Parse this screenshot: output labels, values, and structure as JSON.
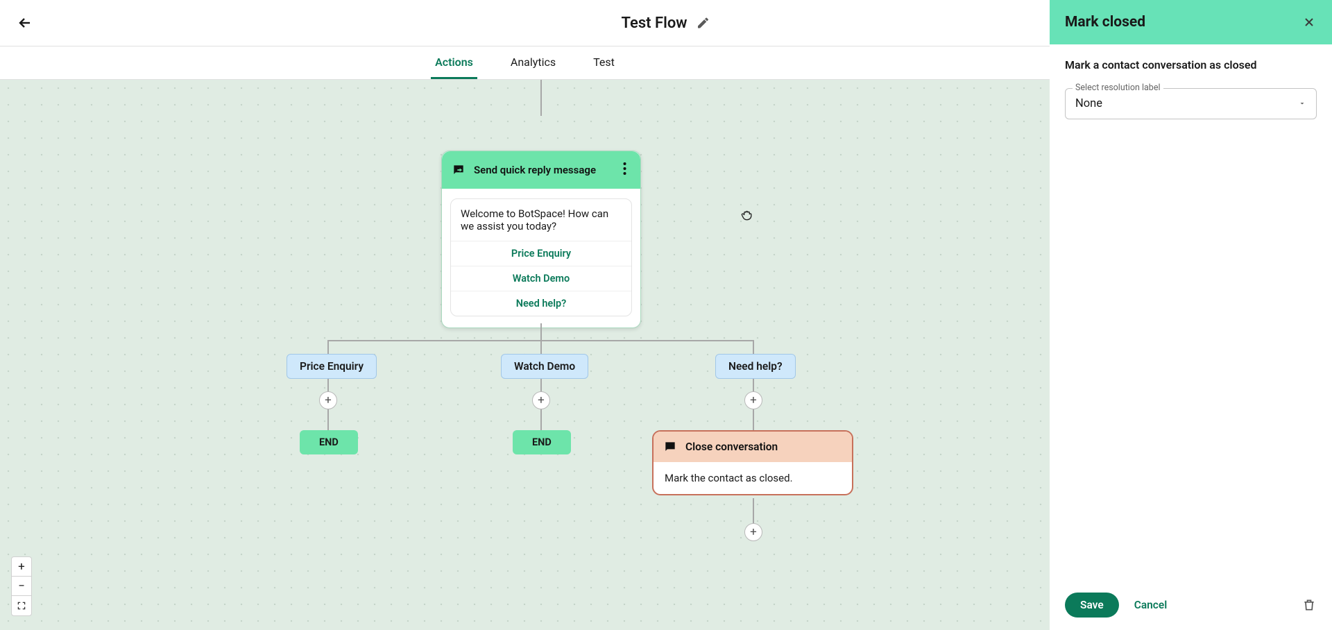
{
  "page_title": "Test Flow",
  "tabs": {
    "actions": "Actions",
    "analytics": "Analytics",
    "test": "Test"
  },
  "quick_reply_node": {
    "title": "Send quick reply message",
    "message": "Welcome to BotSpace! How can we assist you today?",
    "options": [
      "Price Enquiry",
      "Watch Demo",
      "Need help?"
    ]
  },
  "branches": {
    "b1": "Price Enquiry",
    "b2": "Watch Demo",
    "b3": "Need help?"
  },
  "end_label": "END",
  "close_conv_node": {
    "title": "Close conversation",
    "body": "Mark the contact as closed."
  },
  "side_panel": {
    "title": "Mark closed",
    "description": "Mark a contact conversation as closed",
    "select_label": "Select resolution label",
    "select_value": "None",
    "save": "Save",
    "cancel": "Cancel"
  }
}
